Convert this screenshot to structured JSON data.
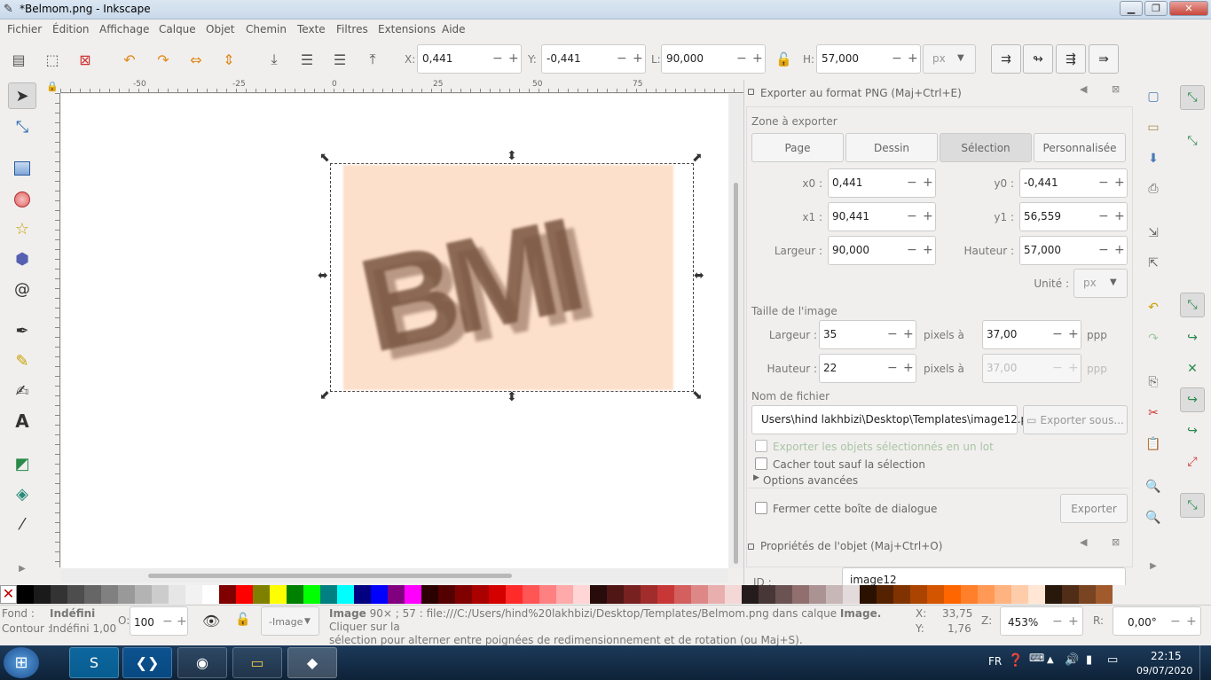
{
  "window": {
    "title": "*Belmom.png - Inkscape",
    "min": "▁",
    "max": "❐",
    "close": "✕"
  },
  "menu": [
    "Fichier",
    "Édition",
    "Affichage",
    "Calque",
    "Objet",
    "Chemin",
    "Texte",
    "Filtres",
    "Extensions",
    "Aide"
  ],
  "toolbar": {
    "x_label": "X:",
    "x_value": "0,441",
    "y_label": "Y:",
    "y_value": "-0,441",
    "w_label": "L:",
    "w_value": "90,000",
    "h_label": "H:",
    "h_value": "57,000",
    "unit": "px"
  },
  "ruler": {
    "ticks": [
      "-50",
      "-25",
      "0",
      "25",
      "50",
      "75"
    ]
  },
  "canvas": {
    "image_text": "BMI"
  },
  "export": {
    "header": "Exporter au format PNG (Maj+Ctrl+E)",
    "zone_title": "Zone à exporter",
    "tabs": [
      "Page",
      "Dessin",
      "Sélection",
      "Personnalisée"
    ],
    "active_tab": "Sélection",
    "x0_label": "x0 :",
    "x0": "0,441",
    "y0_label": "y0 :",
    "y0": "-0,441",
    "x1_label": "x1 :",
    "x1": "90,441",
    "y1_label": "y1 :",
    "y1": "56,559",
    "width_label": "Largeur :",
    "width": "90,000",
    "height_label": "Hauteur :",
    "height": "57,000",
    "unit_label": "Unité :",
    "unit": "px",
    "image_size_title": "Taille de l'image",
    "img_w_label": "Largeur :",
    "img_w": "35",
    "img_w_px": "pixels à",
    "dpi": "37,00",
    "dpi_unit": "ppp",
    "img_h_label": "Hauteur :",
    "img_h": "22",
    "img_h_px": "pixels à",
    "dpi2": "37,00",
    "dpi2_unit": "ppp",
    "filename_title": "Nom de fichier",
    "filename": "Users\\hind lakhbizi\\Desktop\\Templates\\image12.png",
    "export_as": "Exporter sous...",
    "batch": "Exporter les objets sélectionnés en un lot",
    "hide": "Cacher tout sauf la sélection",
    "advanced": "Options avancées",
    "close_dialog": "Fermer cette boîte de dialogue",
    "export_btn": "Exporter"
  },
  "props": {
    "header": "Propriétés de l'objet (Maj+Ctrl+O)",
    "id_label": "ID :",
    "id_value": "image12"
  },
  "palette": [
    "#000000",
    "#1a1a1a",
    "#333333",
    "#4d4d4d",
    "#666666",
    "#808080",
    "#999999",
    "#b3b3b3",
    "#cccccc",
    "#e6e6e6",
    "#f2f2f2",
    "#ffffff",
    "#800000",
    "#ff0000",
    "#808000",
    "#ffff00",
    "#008000",
    "#00ff00",
    "#008080",
    "#00ffff",
    "#000080",
    "#0000ff",
    "#800080",
    "#ff00ff",
    "#2b0000",
    "#550000",
    "#800000",
    "#aa0000",
    "#d40000",
    "#ff2a2a",
    "#ff5555",
    "#ff8080",
    "#ffaaaa",
    "#ffd5d5",
    "#280b0b",
    "#501616",
    "#782121",
    "#a02c2c",
    "#c83737",
    "#d35f5f",
    "#de8787",
    "#e9afaf",
    "#f4d7d7",
    "#241c1c",
    "#483737",
    "#6c5353",
    "#916f6f",
    "#ac9393",
    "#c8b7b7",
    "#e3dbdb",
    "#2b1100",
    "#552200",
    "#803300",
    "#aa4400",
    "#d45500",
    "#ff6600",
    "#ff7f2a",
    "#ff9955",
    "#ffb380",
    "#ffccaa",
    "#ffe6d5",
    "#28170b",
    "#502d16",
    "#784421",
    "#a05a2c"
  ],
  "status": {
    "fill_label": "Fond :",
    "fill_value": "Indéfini",
    "stroke_label": "Contour :",
    "stroke_value": "Indéfini 1,00",
    "opacity_label": "O:",
    "opacity": "100",
    "layer": "-Image",
    "message_bold": "Image",
    "message": "90× ; 57 : file:///C:/Users/hind%20lakhbizi/Desktop/Templates/Belmom.png dans calque",
    "message_bold2": "Image.",
    "message_end": "Cliquer sur la",
    "message2": "sélection pour alterner entre poignées de redimensionnement et de rotation (ou Maj+S).",
    "x_label": "X:",
    "x": "33,75",
    "y_label": "Y:",
    "y": "1,76",
    "z_label": "Z:",
    "zoom": "453%",
    "r_label": "R:",
    "rot": "0,00°"
  },
  "taskbar": {
    "lang": "FR",
    "time": "22:15",
    "date": "09/07/2020"
  }
}
